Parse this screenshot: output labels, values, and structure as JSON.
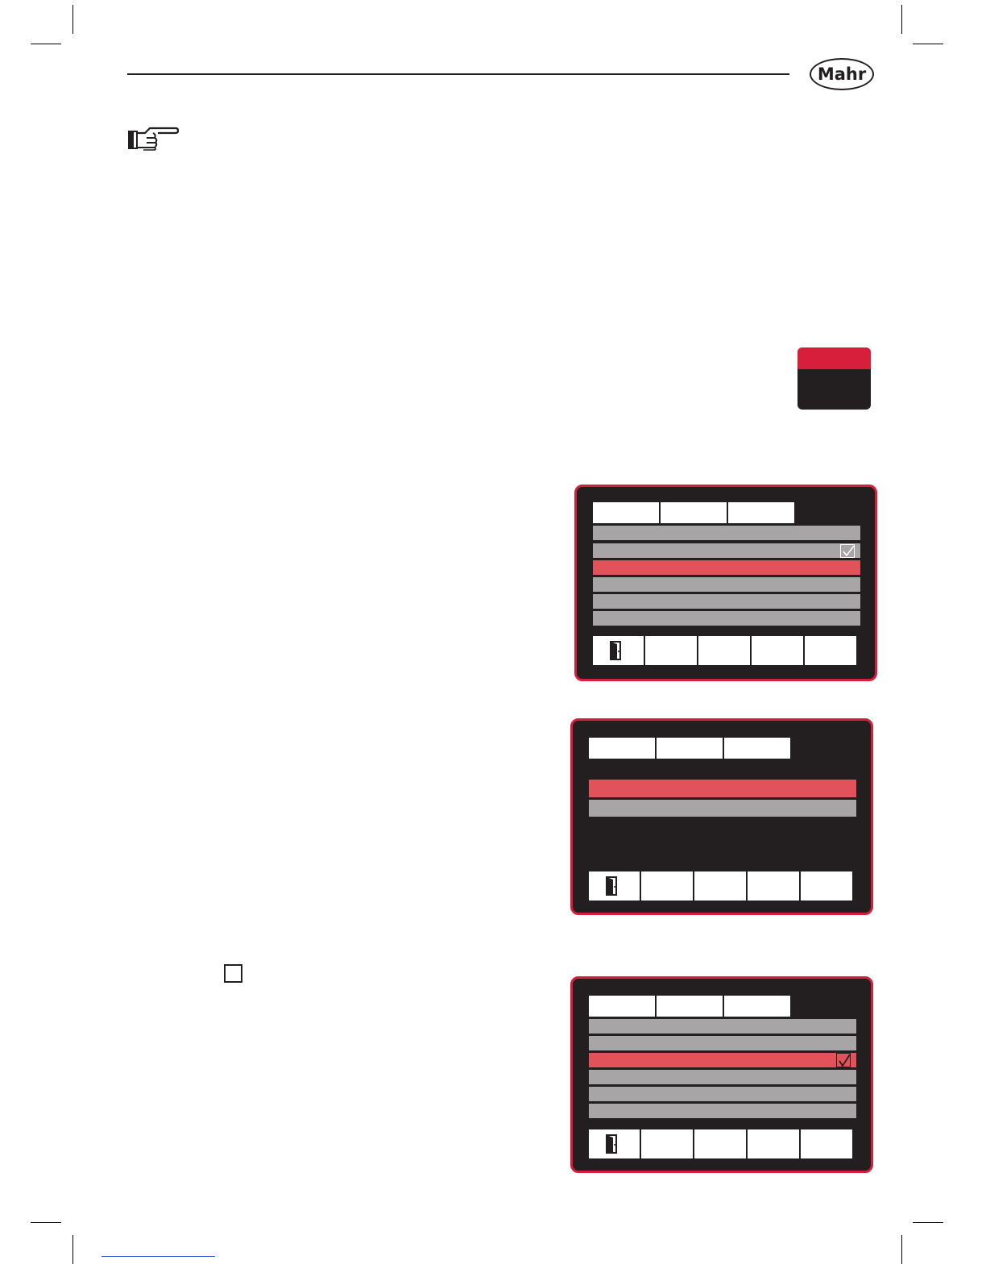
{
  "header": {
    "logo_text": "Mahr"
  },
  "icons": {
    "pointer": "pointing-hand-icon",
    "exit": "exit-door-icon",
    "checkbox": "checkbox-icon"
  },
  "colors": {
    "brand_red": "#d71e3b",
    "selected_row": "#e1525b",
    "row_grey": "#a7a5a6",
    "screen_bg": "#231f20"
  },
  "screens": [
    {
      "name": "screen-1",
      "tabs": 3,
      "rows": 6,
      "selected_row": 3,
      "checked_row": 2,
      "softkeys": 5
    },
    {
      "name": "screen-2",
      "tabs": 3,
      "rows": 2,
      "selected_row": 1,
      "checked_row": null,
      "softkeys": 5
    },
    {
      "name": "screen-3",
      "tabs": 3,
      "rows": 6,
      "selected_row": 3,
      "checked_row": 3,
      "softkeys": 5
    }
  ]
}
